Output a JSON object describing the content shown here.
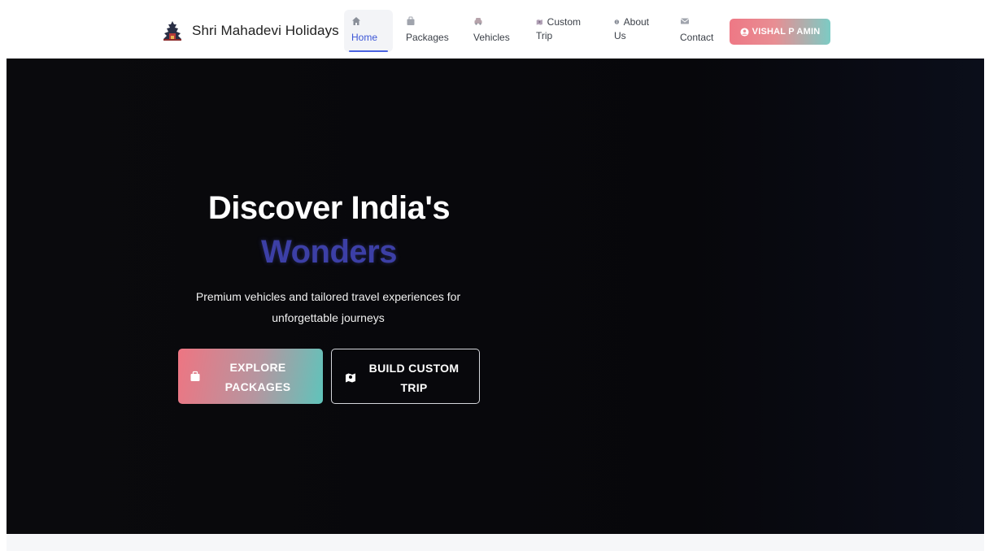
{
  "brand": {
    "name": "Shri Mahadevi Holidays",
    "logo_icon": "temple-logo-icon"
  },
  "nav": {
    "items": [
      {
        "label": "Home",
        "icon": "home-icon",
        "active": true
      },
      {
        "label": "Packages",
        "icon": "suitcase-icon",
        "active": false
      },
      {
        "label": "Vehicles",
        "icon": "car-icon",
        "active": false
      },
      {
        "label": "Custom",
        "label2": "Trip",
        "icon": "map-icon",
        "active": false
      },
      {
        "label": "About",
        "label2": "Us",
        "icon": "info-icon",
        "active": false
      },
      {
        "label": "Contact",
        "icon": "envelope-icon",
        "active": false
      }
    ]
  },
  "user": {
    "label": "VISHAL P AMIN",
    "icon": "user-circle-icon"
  },
  "hero": {
    "title": "Discover India's",
    "accent": "Wonders",
    "subtitle_line1": "Premium vehicles and tailored travel experiences for",
    "subtitle_line2": "unforgettable journeys",
    "explore_line1": "EXPLORE",
    "explore_line2": "PACKAGES",
    "custom_line1": "BUILD CUSTOM",
    "custom_line2": "TRIP"
  },
  "colors": {
    "accent": "#3c3fa6",
    "active_nav": "#3b55d6",
    "gradient_start": "#ee7582",
    "gradient_end": "#5fc4bb",
    "hero_bg": "#07070b"
  }
}
